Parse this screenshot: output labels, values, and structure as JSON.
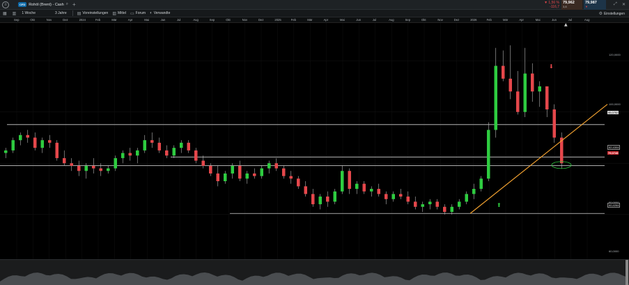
{
  "instrument": {
    "badge": "CFD",
    "name": "Rohöl (Brent) - Cash",
    "change_pct": "▼ 1,56 %",
    "change_abs": "-116,7",
    "bid": "79,962",
    "bid_sub": "3,8",
    "ask": "79,987",
    "ask_sub": "▼"
  },
  "toolbar": {
    "interval": "1 Woche",
    "range": "3 Jahre",
    "presets": "Voreinstellungen",
    "indicator": "Mittel",
    "forum": "Forum",
    "related": "Verwandte",
    "settings": "Einstellungen"
  },
  "time_axis": [
    "Sep",
    "Okt",
    "Nov",
    "Dez",
    "2024",
    "Feb",
    "Mär",
    "Apr",
    "Mai",
    "Jun",
    "Jul",
    "Aug",
    "Sep",
    "Okt",
    "Nov",
    "Dez",
    "2025",
    "Feb",
    "Mär",
    "Apr",
    "Mai",
    "Jun",
    "Jul",
    "Aug",
    "Sep",
    "Okt",
    "Nov",
    "Dez",
    "2026",
    "Feb",
    "Mär",
    "Apr",
    "Mai",
    "Jun",
    "Jul",
    "Aug"
  ],
  "price_axis": [
    "120,0000",
    "100,0000",
    "80,0000",
    "60,0000"
  ],
  "levels": {
    "upper": "95,0752",
    "resist": "82,4304",
    "current": "79,0745",
    "low": "60,4264"
  },
  "colors": {
    "up": "#2ecc40",
    "down": "#e5474b",
    "trend": "#f0a030",
    "background": "#000000"
  },
  "icons": [
    "circle-menu-icon",
    "search-icon",
    "plus-icon",
    "grid-icon",
    "settings-icon",
    "forum-icon",
    "related-icon",
    "up-arrow-icon",
    "down-arrow-icon"
  ],
  "chart_data": {
    "type": "candlestick",
    "title": "",
    "xlabel": "",
    "ylabel": "",
    "ylim": [
      45,
      132
    ],
    "series": [
      {
        "ohlc": [
          [
            84,
            86,
            82,
            85
          ],
          [
            85,
            90,
            84,
            89
          ],
          [
            89,
            92,
            87,
            91
          ],
          [
            91,
            93,
            88,
            90
          ],
          [
            90,
            92,
            85,
            86
          ],
          [
            86,
            90,
            84,
            89
          ],
          [
            89,
            91,
            86,
            88
          ],
          [
            88,
            89,
            81,
            82
          ],
          [
            82,
            85,
            79,
            80
          ],
          [
            80,
            82,
            77,
            79
          ],
          [
            79,
            81,
            75,
            77
          ],
          [
            77,
            80,
            74,
            79
          ],
          [
            79,
            82,
            76,
            78
          ],
          [
            78,
            80,
            75,
            77
          ],
          [
            77,
            79,
            76,
            78
          ],
          [
            78,
            83,
            77,
            82
          ],
          [
            82,
            85,
            80,
            84
          ],
          [
            84,
            86,
            81,
            83
          ],
          [
            83,
            86,
            80,
            85
          ],
          [
            85,
            91,
            84,
            89
          ],
          [
            89,
            92,
            86,
            88
          ],
          [
            88,
            90,
            84,
            85
          ],
          [
            85,
            87,
            82,
            83
          ],
          [
            83,
            87,
            82,
            86
          ],
          [
            86,
            89,
            84,
            88
          ],
          [
            88,
            89,
            84,
            85
          ],
          [
            85,
            86,
            80,
            81
          ],
          [
            81,
            83,
            78,
            79
          ],
          [
            79,
            80,
            75,
            76
          ],
          [
            76,
            79,
            71,
            73
          ],
          [
            73,
            77,
            72,
            76
          ],
          [
            76,
            80,
            74,
            79
          ],
          [
            79,
            81,
            73,
            74
          ],
          [
            74,
            77,
            72,
            76
          ],
          [
            76,
            78,
            74,
            75
          ],
          [
            75,
            79,
            74,
            78
          ],
          [
            78,
            81,
            76,
            80
          ],
          [
            80,
            82,
            77,
            78
          ],
          [
            78,
            79,
            74,
            75
          ],
          [
            75,
            77,
            72,
            74
          ],
          [
            74,
            75,
            70,
            71
          ],
          [
            71,
            73,
            67,
            68
          ],
          [
            68,
            70,
            63,
            64
          ],
          [
            64,
            68,
            62,
            67
          ],
          [
            67,
            69,
            63,
            65
          ],
          [
            65,
            70,
            64,
            69
          ],
          [
            69,
            79,
            68,
            77
          ],
          [
            77,
            78,
            68,
            70
          ],
          [
            70,
            73,
            68,
            72
          ],
          [
            72,
            73,
            68,
            69
          ],
          [
            69,
            71,
            67,
            70
          ],
          [
            70,
            72,
            67,
            68
          ],
          [
            68,
            69,
            64,
            66
          ],
          [
            66,
            69,
            65,
            68
          ],
          [
            68,
            70,
            66,
            67
          ],
          [
            67,
            69,
            64,
            65
          ],
          [
            65,
            67,
            62,
            63
          ],
          [
            63,
            65,
            61,
            64
          ],
          [
            64,
            66,
            62,
            65
          ],
          [
            65,
            66,
            62,
            63
          ],
          [
            63,
            64,
            60,
            61
          ],
          [
            61,
            64,
            60,
            63
          ],
          [
            63,
            66,
            62,
            65
          ],
          [
            65,
            69,
            64,
            68
          ],
          [
            68,
            72,
            66,
            70
          ],
          [
            70,
            75,
            69,
            74
          ],
          [
            74,
            96,
            73,
            93
          ],
          [
            93,
            125,
            90,
            118
          ],
          [
            118,
            124,
            112,
            113
          ],
          [
            113,
            126,
            105,
            108
          ],
          [
            108,
            116,
            99,
            100
          ],
          [
            100,
            125,
            98,
            115
          ],
          [
            115,
            119,
            104,
            108
          ],
          [
            108,
            112,
            102,
            110
          ],
          [
            110,
            108,
            98,
            101
          ],
          [
            101,
            103,
            88,
            90
          ],
          [
            90,
            92,
            78,
            80
          ]
        ]
      }
    ]
  }
}
